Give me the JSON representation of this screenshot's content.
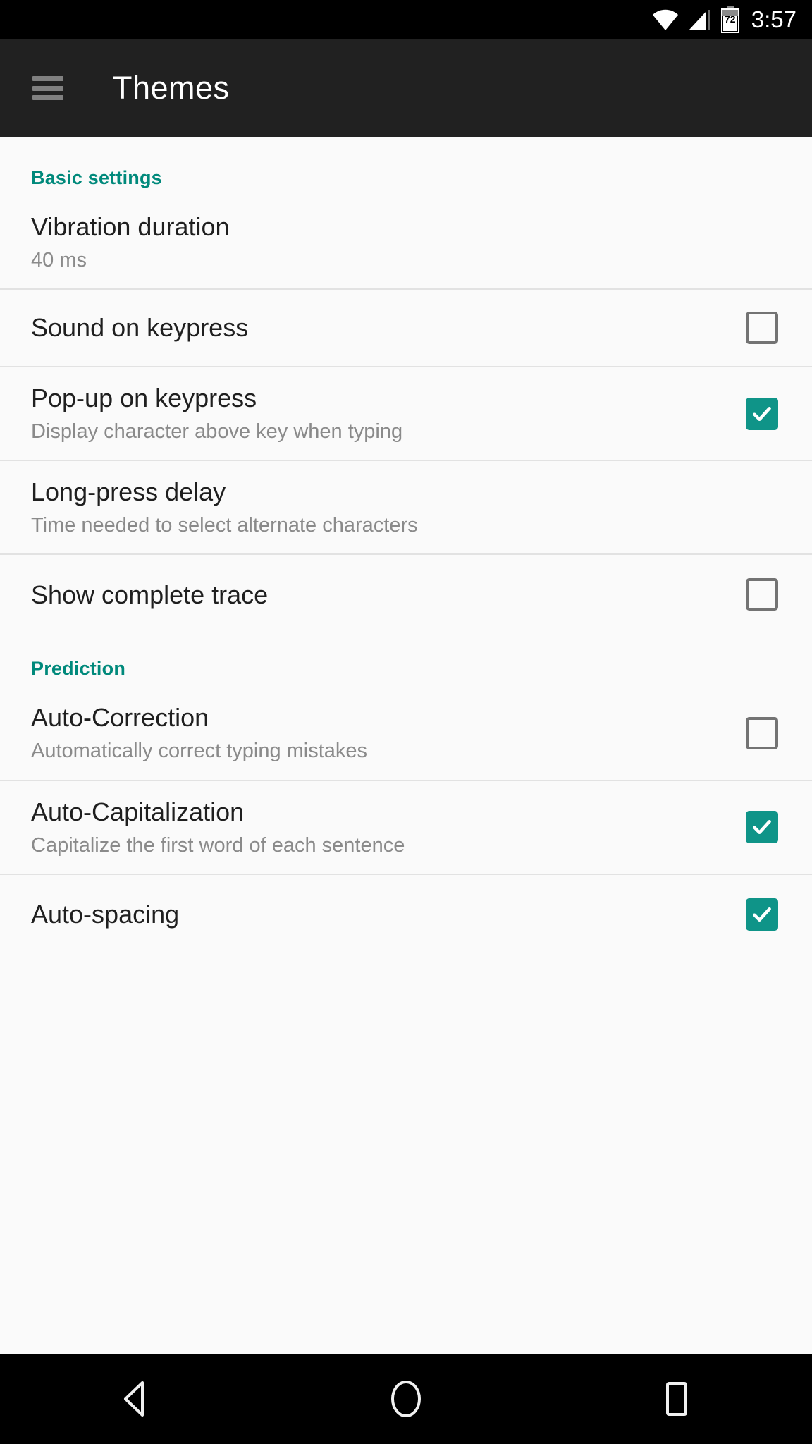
{
  "status_bar": {
    "wifi_icon": "wifi-icon",
    "signal_icon": "cell-signal-icon",
    "battery_icon": "battery-icon",
    "battery_level": "72",
    "time": "3:57"
  },
  "app_bar": {
    "menu_icon": "hamburger-menu-icon",
    "title": "Themes"
  },
  "colors": {
    "accent": "#00897b",
    "checkbox_on": "#0f9488",
    "app_bar_bg": "#212121",
    "content_bg": "#fafafa",
    "title_text": "#1f1f1f",
    "sub_text": "#8a8a8a"
  },
  "sections": [
    {
      "header": "Basic settings",
      "items": [
        {
          "title": "Vibration duration",
          "subtitle": "40 ms",
          "control": "none",
          "checked": false
        },
        {
          "title": "Sound on keypress",
          "subtitle": "",
          "control": "checkbox",
          "checked": false
        },
        {
          "title": "Pop-up on keypress",
          "subtitle": "Display character above key when typing",
          "control": "checkbox",
          "checked": true
        },
        {
          "title": "Long-press delay",
          "subtitle": "Time needed to select alternate characters",
          "control": "none",
          "checked": false
        },
        {
          "title": "Show complete trace",
          "subtitle": "",
          "control": "checkbox",
          "checked": false
        }
      ]
    },
    {
      "header": "Prediction",
      "items": [
        {
          "title": "Auto-Correction",
          "subtitle": "Automatically correct typing mistakes",
          "control": "checkbox",
          "checked": false
        },
        {
          "title": "Auto-Capitalization",
          "subtitle": "Capitalize the first word of each sentence",
          "control": "checkbox",
          "checked": true
        },
        {
          "title": "Auto-spacing",
          "subtitle": "",
          "control": "checkbox",
          "checked": true
        }
      ]
    }
  ],
  "nav_bar": {
    "back_icon": "back-triangle-icon",
    "home_icon": "home-circle-icon",
    "recents_icon": "recents-square-icon"
  }
}
